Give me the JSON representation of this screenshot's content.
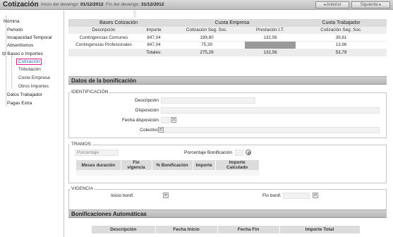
{
  "header": {
    "title": "Cotización",
    "inicio_label": "Inicio del devengo:",
    "inicio_value": "01/12/2012",
    "fin_label": "Fin del devengo:",
    "fin_value": "31/12/2012",
    "prev_label": "Anterior",
    "next_label": "Siguiente"
  },
  "sidebar": {
    "items": [
      {
        "label": "Nómina"
      },
      {
        "label": "Periodo"
      },
      {
        "label": "Incapacidad Temporal"
      },
      {
        "label": "Absentismos"
      },
      {
        "label": "Bases e Importes"
      },
      {
        "label": "Cotización"
      },
      {
        "label": "Tributación"
      },
      {
        "label": "Coste Empresa"
      },
      {
        "label": "Otros Importes"
      },
      {
        "label": "Datos Trabajador"
      },
      {
        "label": "Pagas Extra"
      }
    ],
    "expand_symbol": "⊟"
  },
  "cotizacion": {
    "group_headers": [
      "Bases Cotización",
      "Cuota Empresa",
      "Cuota Trabajador"
    ],
    "columns": [
      "Descripción",
      "Importe",
      "Cotización Seg. Soc.",
      "Prestación I.T.",
      "Cotización Seg. Soc."
    ],
    "rows": [
      {
        "desc": "Contingencias Comunes",
        "importe": "847,04",
        "emp_ss": "199,80",
        "emp_it": "132,56",
        "trab_ss": "39,81"
      },
      {
        "desc": "Contingencias Profesionales",
        "importe": "847,04",
        "emp_ss": "75,39",
        "emp_it": "",
        "trab_ss": "13,98"
      }
    ],
    "totals": {
      "label": "Totales:",
      "emp_ss": "275,29",
      "emp_it": "132,56",
      "trab_ss": "53,79"
    }
  },
  "bonificacion": {
    "section_title": "Datos de la bonificación",
    "identificacion": {
      "legend": "IDENTIFICACIÓN",
      "descripcion_label": "Descripción",
      "disposicion_label": "Disposición",
      "fecha_disposicion_label": "Fecha disposición",
      "colectivo_label": "Colectivo"
    },
    "tramos": {
      "legend": "TRAMOS",
      "porcentaje_placeholder": "Porcentaje",
      "porcentaje_bonificacion_label": "Porcentaje Bonificación",
      "columns": [
        "Meses duración",
        "Fin vigencia",
        "% Bonificación",
        "Importe",
        "Importe Calculado"
      ]
    },
    "vigencia": {
      "legend": "VIGENCIA",
      "inicio_label": "Inicio bonif.",
      "fin_label": "Fin bonif."
    }
  },
  "automaticas": {
    "section_title": "Bonificaciones Automáticas",
    "columns": [
      "Descripción",
      "Fecha Inicio",
      "Fecha Fin",
      "Importe Total"
    ]
  }
}
